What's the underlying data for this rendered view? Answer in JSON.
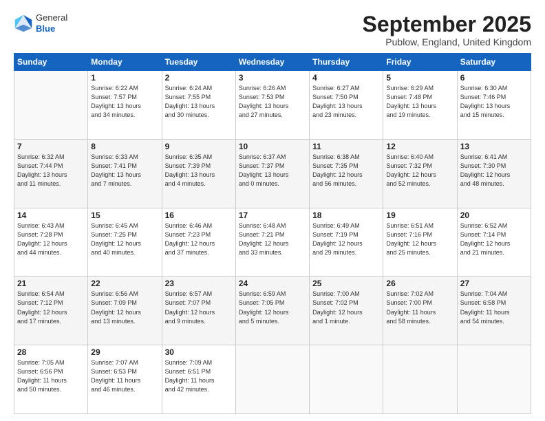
{
  "header": {
    "logo_general": "General",
    "logo_blue": "Blue",
    "title": "September 2025",
    "location": "Publow, England, United Kingdom"
  },
  "weekdays": [
    "Sunday",
    "Monday",
    "Tuesday",
    "Wednesday",
    "Thursday",
    "Friday",
    "Saturday"
  ],
  "weeks": [
    [
      {
        "day": "",
        "info": ""
      },
      {
        "day": "1",
        "info": "Sunrise: 6:22 AM\nSunset: 7:57 PM\nDaylight: 13 hours\nand 34 minutes."
      },
      {
        "day": "2",
        "info": "Sunrise: 6:24 AM\nSunset: 7:55 PM\nDaylight: 13 hours\nand 30 minutes."
      },
      {
        "day": "3",
        "info": "Sunrise: 6:26 AM\nSunset: 7:53 PM\nDaylight: 13 hours\nand 27 minutes."
      },
      {
        "day": "4",
        "info": "Sunrise: 6:27 AM\nSunset: 7:50 PM\nDaylight: 13 hours\nand 23 minutes."
      },
      {
        "day": "5",
        "info": "Sunrise: 6:29 AM\nSunset: 7:48 PM\nDaylight: 13 hours\nand 19 minutes."
      },
      {
        "day": "6",
        "info": "Sunrise: 6:30 AM\nSunset: 7:46 PM\nDaylight: 13 hours\nand 15 minutes."
      }
    ],
    [
      {
        "day": "7",
        "info": "Sunrise: 6:32 AM\nSunset: 7:44 PM\nDaylight: 13 hours\nand 11 minutes."
      },
      {
        "day": "8",
        "info": "Sunrise: 6:33 AM\nSunset: 7:41 PM\nDaylight: 13 hours\nand 7 minutes."
      },
      {
        "day": "9",
        "info": "Sunrise: 6:35 AM\nSunset: 7:39 PM\nDaylight: 13 hours\nand 4 minutes."
      },
      {
        "day": "10",
        "info": "Sunrise: 6:37 AM\nSunset: 7:37 PM\nDaylight: 13 hours\nand 0 minutes."
      },
      {
        "day": "11",
        "info": "Sunrise: 6:38 AM\nSunset: 7:35 PM\nDaylight: 12 hours\nand 56 minutes."
      },
      {
        "day": "12",
        "info": "Sunrise: 6:40 AM\nSunset: 7:32 PM\nDaylight: 12 hours\nand 52 minutes."
      },
      {
        "day": "13",
        "info": "Sunrise: 6:41 AM\nSunset: 7:30 PM\nDaylight: 12 hours\nand 48 minutes."
      }
    ],
    [
      {
        "day": "14",
        "info": "Sunrise: 6:43 AM\nSunset: 7:28 PM\nDaylight: 12 hours\nand 44 minutes."
      },
      {
        "day": "15",
        "info": "Sunrise: 6:45 AM\nSunset: 7:25 PM\nDaylight: 12 hours\nand 40 minutes."
      },
      {
        "day": "16",
        "info": "Sunrise: 6:46 AM\nSunset: 7:23 PM\nDaylight: 12 hours\nand 37 minutes."
      },
      {
        "day": "17",
        "info": "Sunrise: 6:48 AM\nSunset: 7:21 PM\nDaylight: 12 hours\nand 33 minutes."
      },
      {
        "day": "18",
        "info": "Sunrise: 6:49 AM\nSunset: 7:19 PM\nDaylight: 12 hours\nand 29 minutes."
      },
      {
        "day": "19",
        "info": "Sunrise: 6:51 AM\nSunset: 7:16 PM\nDaylight: 12 hours\nand 25 minutes."
      },
      {
        "day": "20",
        "info": "Sunrise: 6:52 AM\nSunset: 7:14 PM\nDaylight: 12 hours\nand 21 minutes."
      }
    ],
    [
      {
        "day": "21",
        "info": "Sunrise: 6:54 AM\nSunset: 7:12 PM\nDaylight: 12 hours\nand 17 minutes."
      },
      {
        "day": "22",
        "info": "Sunrise: 6:56 AM\nSunset: 7:09 PM\nDaylight: 12 hours\nand 13 minutes."
      },
      {
        "day": "23",
        "info": "Sunrise: 6:57 AM\nSunset: 7:07 PM\nDaylight: 12 hours\nand 9 minutes."
      },
      {
        "day": "24",
        "info": "Sunrise: 6:59 AM\nSunset: 7:05 PM\nDaylight: 12 hours\nand 5 minutes."
      },
      {
        "day": "25",
        "info": "Sunrise: 7:00 AM\nSunset: 7:02 PM\nDaylight: 12 hours\nand 1 minute."
      },
      {
        "day": "26",
        "info": "Sunrise: 7:02 AM\nSunset: 7:00 PM\nDaylight: 11 hours\nand 58 minutes."
      },
      {
        "day": "27",
        "info": "Sunrise: 7:04 AM\nSunset: 6:58 PM\nDaylight: 11 hours\nand 54 minutes."
      }
    ],
    [
      {
        "day": "28",
        "info": "Sunrise: 7:05 AM\nSunset: 6:56 PM\nDaylight: 11 hours\nand 50 minutes."
      },
      {
        "day": "29",
        "info": "Sunrise: 7:07 AM\nSunset: 6:53 PM\nDaylight: 11 hours\nand 46 minutes."
      },
      {
        "day": "30",
        "info": "Sunrise: 7:09 AM\nSunset: 6:51 PM\nDaylight: 11 hours\nand 42 minutes."
      },
      {
        "day": "",
        "info": ""
      },
      {
        "day": "",
        "info": ""
      },
      {
        "day": "",
        "info": ""
      },
      {
        "day": "",
        "info": ""
      }
    ]
  ]
}
